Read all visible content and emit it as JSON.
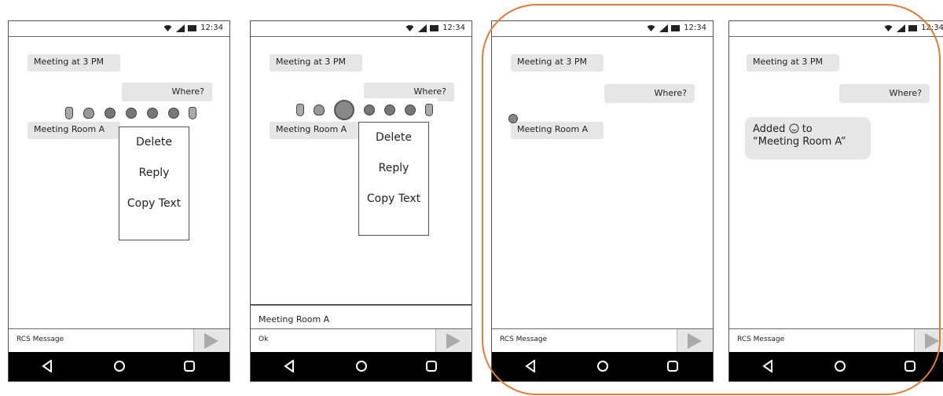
{
  "status_bar": {
    "time": "12:34",
    "icons": [
      "wifi-icon",
      "signal-icon",
      "battery-icon"
    ]
  },
  "conversation": {
    "msg_received_1": "Meeting at 3 PM",
    "msg_sent_1": "Where?",
    "msg_received_2": "Meeting Room A"
  },
  "reactions": [
    "thumbs-up",
    "heart",
    "smile",
    "surprised",
    "sad",
    "angry",
    "thumbs-down"
  ],
  "context_menu": {
    "delete": "Delete",
    "reply": "Reply",
    "copy": "Copy Text"
  },
  "compose": {
    "placeholder": "RCS Message",
    "ok_text": "Ok"
  },
  "preview": {
    "text": "Meeting Room A"
  },
  "added_note": {
    "line1": "Added",
    "line2": "to",
    "line3": "“Meeting Room A”"
  },
  "colors": {
    "highlight": "#e07b39",
    "bubble": "#e6e6e6",
    "nav": "#000000"
  }
}
